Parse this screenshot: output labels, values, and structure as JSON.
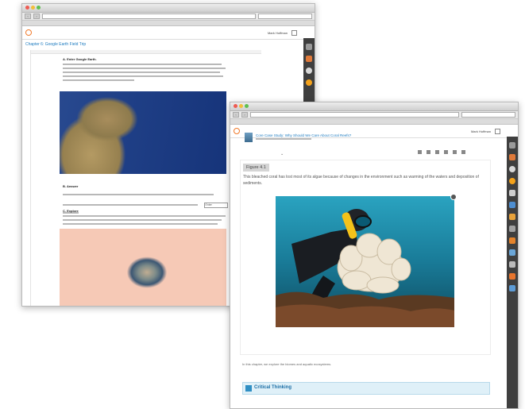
{
  "colors": {
    "accent": "#1f7cc0",
    "brand": "#f07a2b",
    "rail": "#3f3f3f"
  },
  "window_a": {
    "user_name": "Mark Hoffman",
    "chapter_title": "Chapter 6: Google Earth Field Trip",
    "step_a_heading": "A. Enter Google Earth.",
    "step_b_heading": "B. Answer",
    "step_c_heading": "C. Explore",
    "answer_field": "Enter",
    "rail_icons": [
      "home-icon",
      "notes-icon",
      "globe-icon",
      "badge-icon"
    ]
  },
  "window_b": {
    "user_name": "Mark Hoffman",
    "lesson_title": "Core Case Study: Why Should We Care About Coral Reefs?",
    "figure_label": "Figure 4.1",
    "figure_caption": "This bleached coral has lost most of its algae because of changes in the environment such as warming of the waters and deposition of sediments.",
    "photo_credit": "",
    "para_text": "In this chapter, we explore the biomes and aquatic ecosystems.",
    "critical_label": "Critical Thinking",
    "critical_text": "",
    "rail_icons": [
      "home-icon",
      "notes-icon",
      "globe-icon",
      "dictionary-icon",
      "bookmark-icon",
      "share-icon",
      "flashcard-icon",
      "quiz-icon",
      "video-icon",
      "highlight-icon",
      "link-icon",
      "settings-icon",
      "help-icon"
    ]
  }
}
